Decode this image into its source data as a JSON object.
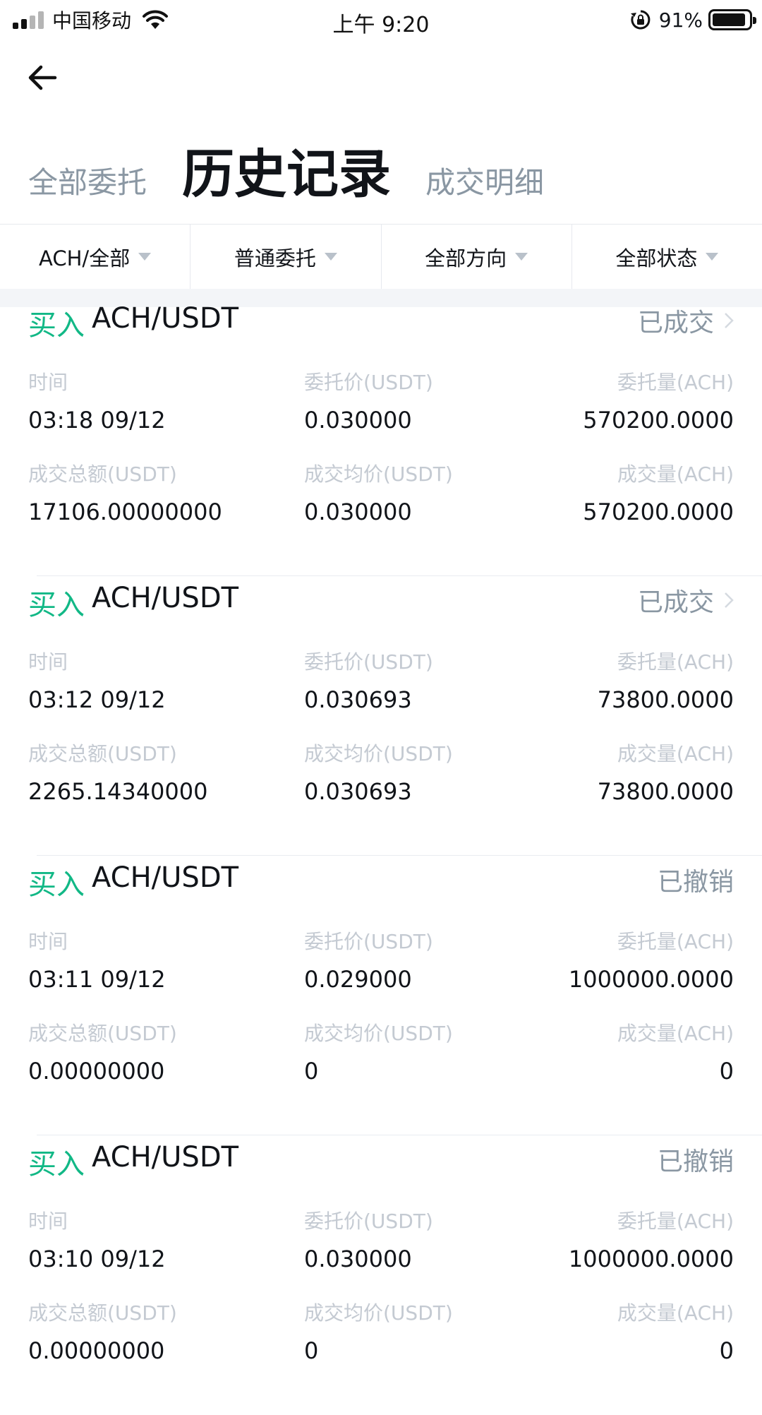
{
  "status_bar": {
    "carrier": "中国移动",
    "time": "上午 9:20",
    "battery": "91%"
  },
  "tabs": [
    {
      "label": "全部委托"
    },
    {
      "label": "历史记录"
    },
    {
      "label": "成交明细"
    }
  ],
  "filters": [
    {
      "label": "ACH/全部"
    },
    {
      "label": "普通委托"
    },
    {
      "label": "全部方向"
    },
    {
      "label": "全部状态"
    }
  ],
  "labels": {
    "time": "时间",
    "price": "委托价(USDT)",
    "amount": "委托量(ACH)",
    "total": "成交总额(USDT)",
    "avg": "成交均价(USDT)",
    "filled": "成交量(ACH)"
  },
  "orders": [
    {
      "side": "买入",
      "pair": "ACH/USDT",
      "status": "已成交",
      "time": "03:18 09/12",
      "price": "0.030000",
      "amount": "570200.0000",
      "total": "17106.00000000",
      "avg": "0.030000",
      "filled": "570200.0000"
    },
    {
      "side": "买入",
      "pair": "ACH/USDT",
      "status": "已成交",
      "time": "03:12 09/12",
      "price": "0.030693",
      "amount": "73800.0000",
      "total": "2265.14340000",
      "avg": "0.030693",
      "filled": "73800.0000"
    },
    {
      "side": "买入",
      "pair": "ACH/USDT",
      "status": "已撤销",
      "time": "03:11 09/12",
      "price": "0.029000",
      "amount": "1000000.0000",
      "total": "0.00000000",
      "avg": "0",
      "filled": "0"
    },
    {
      "side": "买入",
      "pair": "ACH/USDT",
      "status": "已撤销",
      "time": "03:10 09/12",
      "price": "0.030000",
      "amount": "1000000.0000",
      "total": "0.00000000",
      "avg": "0",
      "filled": "0"
    }
  ],
  "colors": {
    "buy": "#12b886",
    "muted": "#8a97a3",
    "label": "#c4cad2"
  }
}
